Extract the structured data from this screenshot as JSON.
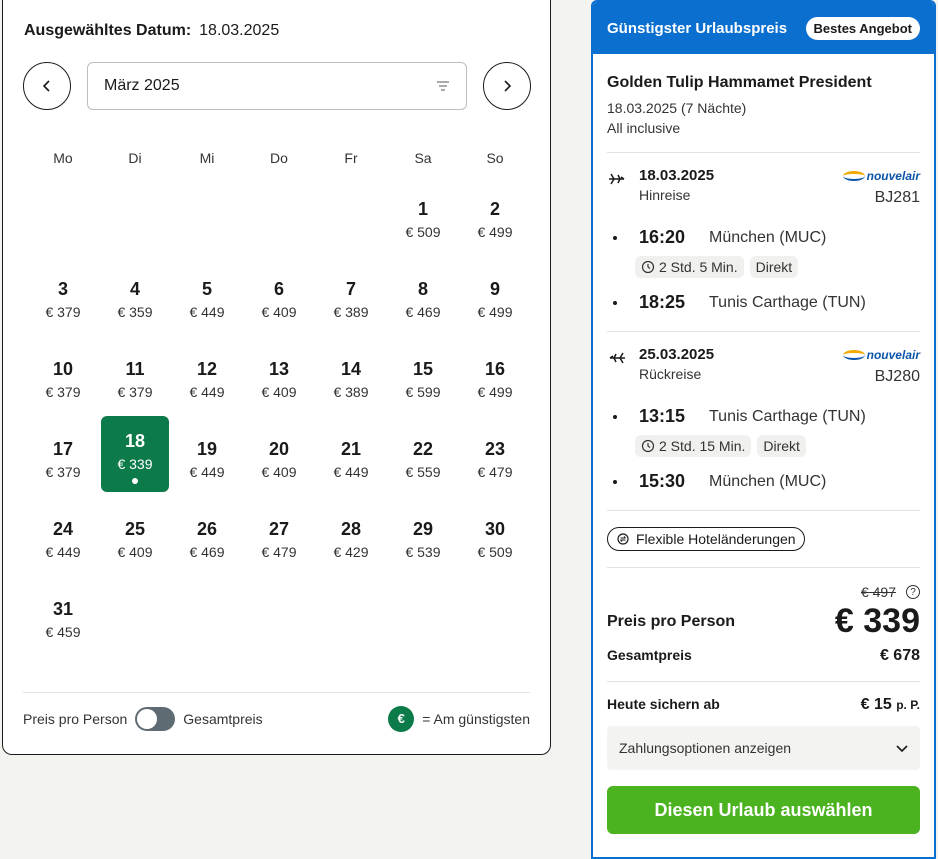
{
  "calendar": {
    "selected_label": "Ausgewähltes Datum:",
    "selected_value": "18.03.2025",
    "month": "März 2025",
    "weekdays": [
      "Mo",
      "Di",
      "Mi",
      "Do",
      "Fr",
      "Sa",
      "So"
    ],
    "days": [
      {
        "n": "1",
        "p": "€ 509"
      },
      {
        "n": "2",
        "p": "€ 499"
      },
      {
        "n": "3",
        "p": "€ 379"
      },
      {
        "n": "4",
        "p": "€ 359"
      },
      {
        "n": "5",
        "p": "€ 449"
      },
      {
        "n": "6",
        "p": "€ 409"
      },
      {
        "n": "7",
        "p": "€ 389"
      },
      {
        "n": "8",
        "p": "€ 469"
      },
      {
        "n": "9",
        "p": "€ 499"
      },
      {
        "n": "10",
        "p": "€ 379"
      },
      {
        "n": "11",
        "p": "€ 379"
      },
      {
        "n": "12",
        "p": "€ 449"
      },
      {
        "n": "13",
        "p": "€ 409"
      },
      {
        "n": "14",
        "p": "€ 389"
      },
      {
        "n": "15",
        "p": "€ 599"
      },
      {
        "n": "16",
        "p": "€ 499"
      },
      {
        "n": "17",
        "p": "€ 379"
      },
      {
        "n": "18",
        "p": "€ 339",
        "selected": true
      },
      {
        "n": "19",
        "p": "€ 449"
      },
      {
        "n": "20",
        "p": "€ 409"
      },
      {
        "n": "21",
        "p": "€ 449"
      },
      {
        "n": "22",
        "p": "€ 559"
      },
      {
        "n": "23",
        "p": "€ 479"
      },
      {
        "n": "24",
        "p": "€ 449"
      },
      {
        "n": "25",
        "p": "€ 409"
      },
      {
        "n": "26",
        "p": "€ 469"
      },
      {
        "n": "27",
        "p": "€ 479"
      },
      {
        "n": "28",
        "p": "€ 429"
      },
      {
        "n": "29",
        "p": "€ 539"
      },
      {
        "n": "30",
        "p": "€ 509"
      },
      {
        "n": "31",
        "p": "€ 459"
      }
    ],
    "leading_blanks": 5,
    "footer": {
      "per_person": "Preis pro Person",
      "total": "Gesamtpreis",
      "badge": "€",
      "legend": "= Am günstigsten"
    }
  },
  "offer": {
    "header": "Günstigster Urlaubspreis",
    "badge": "Bestes Angebot",
    "hotel": "Golden Tulip Hammamet President",
    "dates": "18.03.2025 (7 Nächte)",
    "board": "All inclusive",
    "outbound": {
      "date": "18.03.2025",
      "type": "Hinreise",
      "airline": "nouvelair",
      "flight_no": "BJ281",
      "dep_time": "16:20",
      "dep_airport": "München (MUC)",
      "duration": "2 Std. 5 Min.",
      "direct": "Direkt",
      "arr_time": "18:25",
      "arr_airport": "Tunis Carthage (TUN)"
    },
    "inbound": {
      "date": "25.03.2025",
      "type": "Rückreise",
      "airline": "nouvelair",
      "flight_no": "BJ280",
      "dep_time": "13:15",
      "dep_airport": "Tunis Carthage (TUN)",
      "duration": "2 Std. 15 Min.",
      "direct": "Direkt",
      "arr_time": "15:30",
      "arr_airport": "München (MUC)"
    },
    "flex": "Flexible Hoteländerungen",
    "old_price": "€ 497",
    "pp_label": "Preis pro Person",
    "pp_value": "€ 339",
    "total_label": "Gesamtpreis",
    "total_value": "€ 678",
    "secure_label": "Heute sichern ab",
    "secure_value": "€ 15",
    "secure_unit": "p. P.",
    "payment_options": "Zahlungsoptionen anzeigen",
    "cta": "Diesen Urlaub auswählen"
  },
  "colors": {
    "accent_blue": "#0a6fcf",
    "selected_green": "#0d7a4a",
    "cta_green": "#4ab31f"
  }
}
